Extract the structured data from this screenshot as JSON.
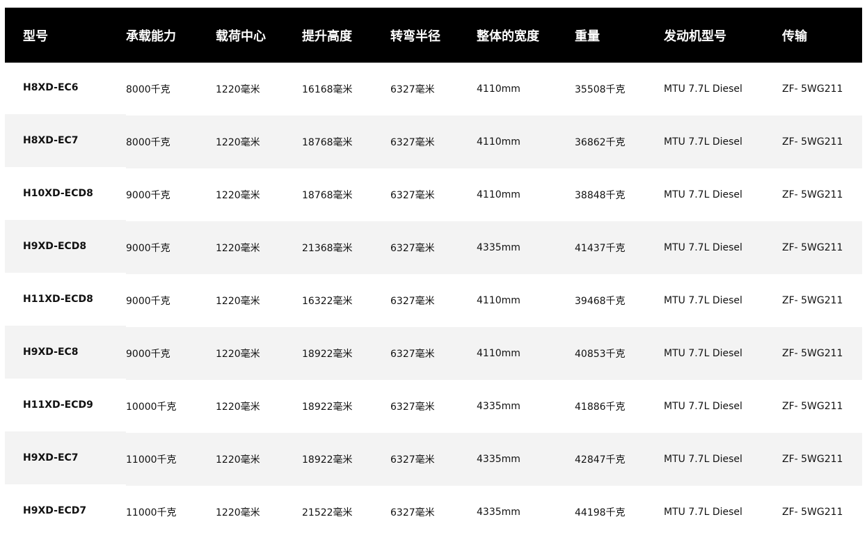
{
  "headers": [
    "型号",
    "承载能力",
    "载荷中心",
    "提升高度",
    "转弯半径",
    "整体的宽度",
    "重量",
    "发动机型号",
    "传输"
  ],
  "rows": [
    [
      "H8XD-EC6",
      "8000千克",
      "1220毫米",
      "16168毫米",
      "6327毫米",
      "4110mm",
      "35508千克",
      "MTU 7.7L Diesel",
      "ZF- 5WG211"
    ],
    [
      "H8XD-EC7",
      "8000千克",
      "1220毫米",
      "18768毫米",
      "6327毫米",
      "4110mm",
      "36862千克",
      "MTU 7.7L Diesel",
      "ZF- 5WG211"
    ],
    [
      "H10XD-ECD8",
      "9000千克",
      "1220毫米",
      "18768毫米",
      "6327毫米",
      "4110mm",
      "38848千克",
      "MTU 7.7L Diesel",
      "ZF- 5WG211"
    ],
    [
      "H9XD-ECD8",
      "9000千克",
      "1220毫米",
      "21368毫米",
      "6327毫米",
      "4335mm",
      "41437千克",
      "MTU 7.7L Diesel",
      "ZF- 5WG211"
    ],
    [
      "H11XD-ECD8",
      "9000千克",
      "1220毫米",
      "16322毫米",
      "6327毫米",
      "4110mm",
      "39468千克",
      "MTU 7.7L Diesel",
      "ZF- 5WG211"
    ],
    [
      "H9XD-EC8",
      "9000千克",
      "1220毫米",
      "18922毫米",
      "6327毫米",
      "4110mm",
      "40853千克",
      "MTU 7.7L Diesel",
      "ZF- 5WG211"
    ],
    [
      "H11XD-ECD9",
      "10000千克",
      "1220毫米",
      "18922毫米",
      "6327毫米",
      "4335mm",
      "41886千克",
      "MTU 7.7L Diesel",
      "ZF- 5WG211"
    ],
    [
      "H9XD-EC7",
      "11000千克",
      "1220毫米",
      "18922毫米",
      "6327毫米",
      "4335mm",
      "42847千克",
      "MTU 7.7L Diesel",
      "ZF- 5WG211"
    ],
    [
      "H9XD-ECD7",
      "11000千克",
      "1220毫米",
      "21522毫米",
      "6327毫米",
      "4335mm",
      "44198千克",
      "MTU 7.7L Diesel",
      "ZF- 5WG211"
    ]
  ]
}
